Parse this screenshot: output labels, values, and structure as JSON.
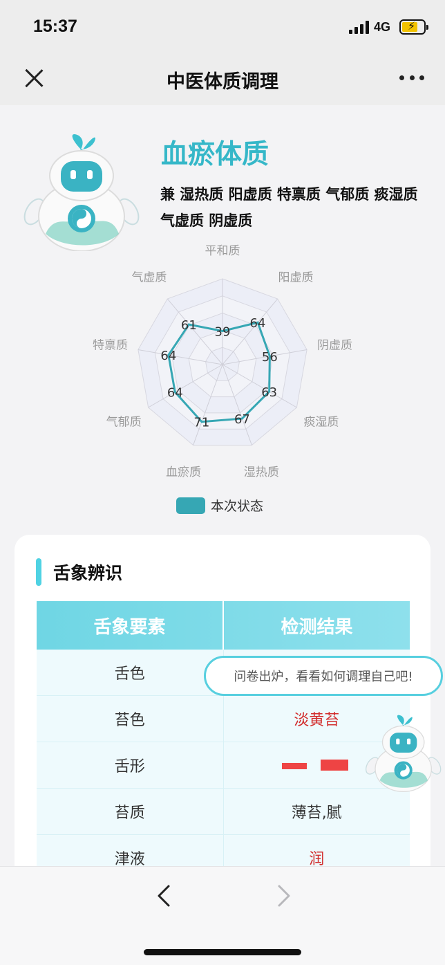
{
  "status_bar": {
    "time": "15:37",
    "network": "4G"
  },
  "nav": {
    "title": "中医体质调理",
    "close_icon": "close-icon",
    "more_icon": "more-icon"
  },
  "result": {
    "main_constitution": "血瘀体质",
    "secondary_constitutions": "兼 湿热质 阳虚质 特禀质 气郁质 痰湿质 气虚质 阴虚质"
  },
  "chart_data": {
    "type": "radar",
    "axes": [
      "平和质",
      "阳虚质",
      "阴虚质",
      "痰湿质",
      "湿热质",
      "血瘀质",
      "气郁质",
      "特禀质",
      "气虚质"
    ],
    "series": [
      {
        "name": "本次状态",
        "values": [
          39,
          64,
          56,
          63,
          67,
          71,
          64,
          64,
          61
        ],
        "color": "#36a7b4"
      }
    ],
    "range": [
      0,
      100
    ],
    "rings": 5,
    "legend_position": "bottom"
  },
  "tongue": {
    "section_title": "舌象辨识",
    "headers": [
      "舌象要素",
      "检测结果"
    ],
    "rows": [
      {
        "element": "舌色",
        "result": ""
      },
      {
        "element": "苔色",
        "result": "淡黄苔"
      },
      {
        "element": "舌形",
        "result": ""
      },
      {
        "element": "苔质",
        "result": "薄苔,腻"
      },
      {
        "element": "津液",
        "result": "润"
      }
    ]
  },
  "bubble": {
    "text": "问卷出炉，看看如何调理自己吧!"
  },
  "colors": {
    "accent": "#35b7c8",
    "series": "#36a7b4",
    "result_red": "#d22d2d"
  }
}
